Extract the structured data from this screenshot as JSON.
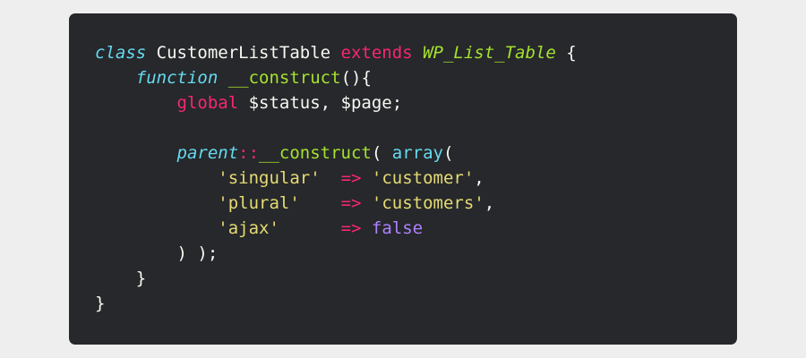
{
  "code": {
    "language": "php",
    "theme": {
      "background": "#26282b",
      "page_background": "#eeeeee",
      "keyword": "#f92672",
      "storage": "#66d9ef",
      "function": "#a6e22e",
      "string": "#e6db74",
      "constant": "#ae81ff",
      "text": "#f8f8f2"
    },
    "lines": [
      [
        {
          "t": "class",
          "k": "kw-storage"
        },
        {
          "t": " CustomerListTable ",
          "k": "cls"
        },
        {
          "t": "extends",
          "k": "kw"
        },
        {
          "t": " ",
          "k": "punct"
        },
        {
          "t": "WP_List_Table",
          "k": "inherit"
        },
        {
          "t": " {",
          "k": "punct"
        }
      ],
      [
        {
          "t": "    ",
          "k": "punct"
        },
        {
          "t": "function",
          "k": "kw-storage"
        },
        {
          "t": " ",
          "k": "punct"
        },
        {
          "t": "__construct",
          "k": "fn"
        },
        {
          "t": "(){",
          "k": "punct"
        }
      ],
      [
        {
          "t": "        ",
          "k": "punct"
        },
        {
          "t": "global",
          "k": "kw"
        },
        {
          "t": " $status, $page;",
          "k": "var"
        }
      ],
      [],
      [
        {
          "t": "        ",
          "k": "punct"
        },
        {
          "t": "parent",
          "k": "kw-storage"
        },
        {
          "t": "::",
          "k": "op"
        },
        {
          "t": "__construct",
          "k": "fn"
        },
        {
          "t": "( ",
          "k": "punct"
        },
        {
          "t": "array",
          "k": "builtin"
        },
        {
          "t": "(",
          "k": "punct"
        }
      ],
      [
        {
          "t": "            ",
          "k": "punct"
        },
        {
          "t": "'singular'",
          "k": "str"
        },
        {
          "t": "  ",
          "k": "punct"
        },
        {
          "t": "=>",
          "k": "op"
        },
        {
          "t": " ",
          "k": "punct"
        },
        {
          "t": "'customer'",
          "k": "str"
        },
        {
          "t": ",",
          "k": "punct"
        }
      ],
      [
        {
          "t": "            ",
          "k": "punct"
        },
        {
          "t": "'plural'",
          "k": "str"
        },
        {
          "t": "    ",
          "k": "punct"
        },
        {
          "t": "=>",
          "k": "op"
        },
        {
          "t": " ",
          "k": "punct"
        },
        {
          "t": "'customers'",
          "k": "str"
        },
        {
          "t": ",",
          "k": "punct"
        }
      ],
      [
        {
          "t": "            ",
          "k": "punct"
        },
        {
          "t": "'ajax'",
          "k": "str"
        },
        {
          "t": "      ",
          "k": "punct"
        },
        {
          "t": "=>",
          "k": "op"
        },
        {
          "t": " ",
          "k": "punct"
        },
        {
          "t": "false",
          "k": "const"
        }
      ],
      [
        {
          "t": "        ) );",
          "k": "punct"
        }
      ],
      [
        {
          "t": "    }",
          "k": "punct"
        }
      ],
      [
        {
          "t": "}",
          "k": "punct"
        }
      ]
    ]
  }
}
